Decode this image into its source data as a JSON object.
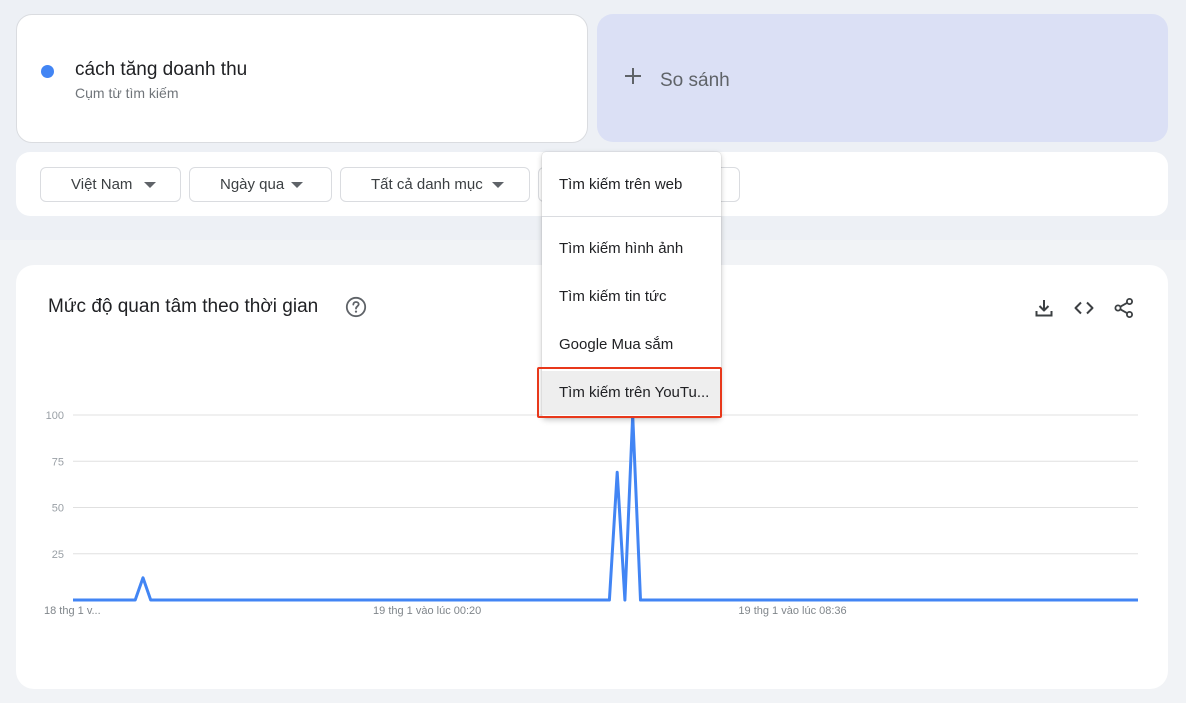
{
  "colors": {
    "series": "#4285f4",
    "compare_bg": "#dbe0f5",
    "highlight": "#e8381b",
    "grid": "#e0e0e0"
  },
  "search_term": {
    "title": "cách tăng doanh thu",
    "subtitle": "Cụm từ tìm kiếm"
  },
  "compare": {
    "label": "So sánh",
    "icon": "plus-icon"
  },
  "filters": [
    {
      "label": "Việt Nam",
      "icon": "caret-down-icon"
    },
    {
      "label": "Ngày qua",
      "icon": "caret-down-icon"
    },
    {
      "label": "Tất cả danh mục",
      "icon": "caret-down-icon"
    },
    {
      "label": "",
      "icon": ""
    }
  ],
  "search_type_menu": {
    "items": [
      "Tìm kiếm trên web",
      "Tìm kiếm hình ảnh",
      "Tìm kiếm tin tức",
      "Google Mua sắm",
      "Tìm kiếm trên YouTu..."
    ],
    "selected_index": 4
  },
  "chart_card": {
    "title": "Mức độ quan tâm theo thời gian",
    "help_icon": "help-circle-icon",
    "tools": [
      "download-icon",
      "embed-code-icon",
      "share-icon"
    ]
  },
  "chart_data": {
    "type": "line",
    "title": "",
    "xlabel": "",
    "ylabel": "",
    "ylim": [
      0,
      100
    ],
    "yticks": [
      25,
      50,
      75,
      100
    ],
    "grid": true,
    "x_tick_labels": [
      {
        "index": 0,
        "label": "18 thg 1 v..."
      },
      {
        "index": 44,
        "label": "19 thg 1 vào lúc 00:20"
      },
      {
        "index": 91,
        "label": "19 thg 1 vào lúc 08:36"
      }
    ],
    "series": [
      {
        "values": [
          0,
          0,
          0,
          0,
          0,
          0,
          0,
          0,
          0,
          12,
          0,
          0,
          0,
          0,
          0,
          0,
          0,
          0,
          0,
          0,
          0,
          0,
          0,
          0,
          0,
          0,
          0,
          0,
          0,
          0,
          0,
          0,
          0,
          0,
          0,
          0,
          0,
          0,
          0,
          0,
          0,
          0,
          0,
          0,
          0,
          0,
          0,
          0,
          0,
          0,
          0,
          0,
          0,
          0,
          0,
          0,
          0,
          0,
          0,
          0,
          0,
          0,
          0,
          0,
          0,
          0,
          0,
          0,
          0,
          0,
          69,
          0,
          100,
          0,
          0,
          0,
          0,
          0,
          0,
          0,
          0,
          0,
          0,
          0,
          0,
          0,
          0,
          0,
          0,
          0,
          0,
          0,
          0,
          0,
          0,
          0,
          0,
          0,
          0,
          0,
          0,
          0,
          0,
          0,
          0,
          0,
          0,
          0,
          0,
          0,
          0,
          0,
          0,
          0,
          0,
          0,
          0,
          0,
          0,
          0,
          0,
          0,
          0,
          0,
          0,
          0,
          0,
          0,
          0,
          0,
          0,
          0,
          0,
          0,
          0,
          0,
          0,
          0
        ]
      }
    ]
  }
}
